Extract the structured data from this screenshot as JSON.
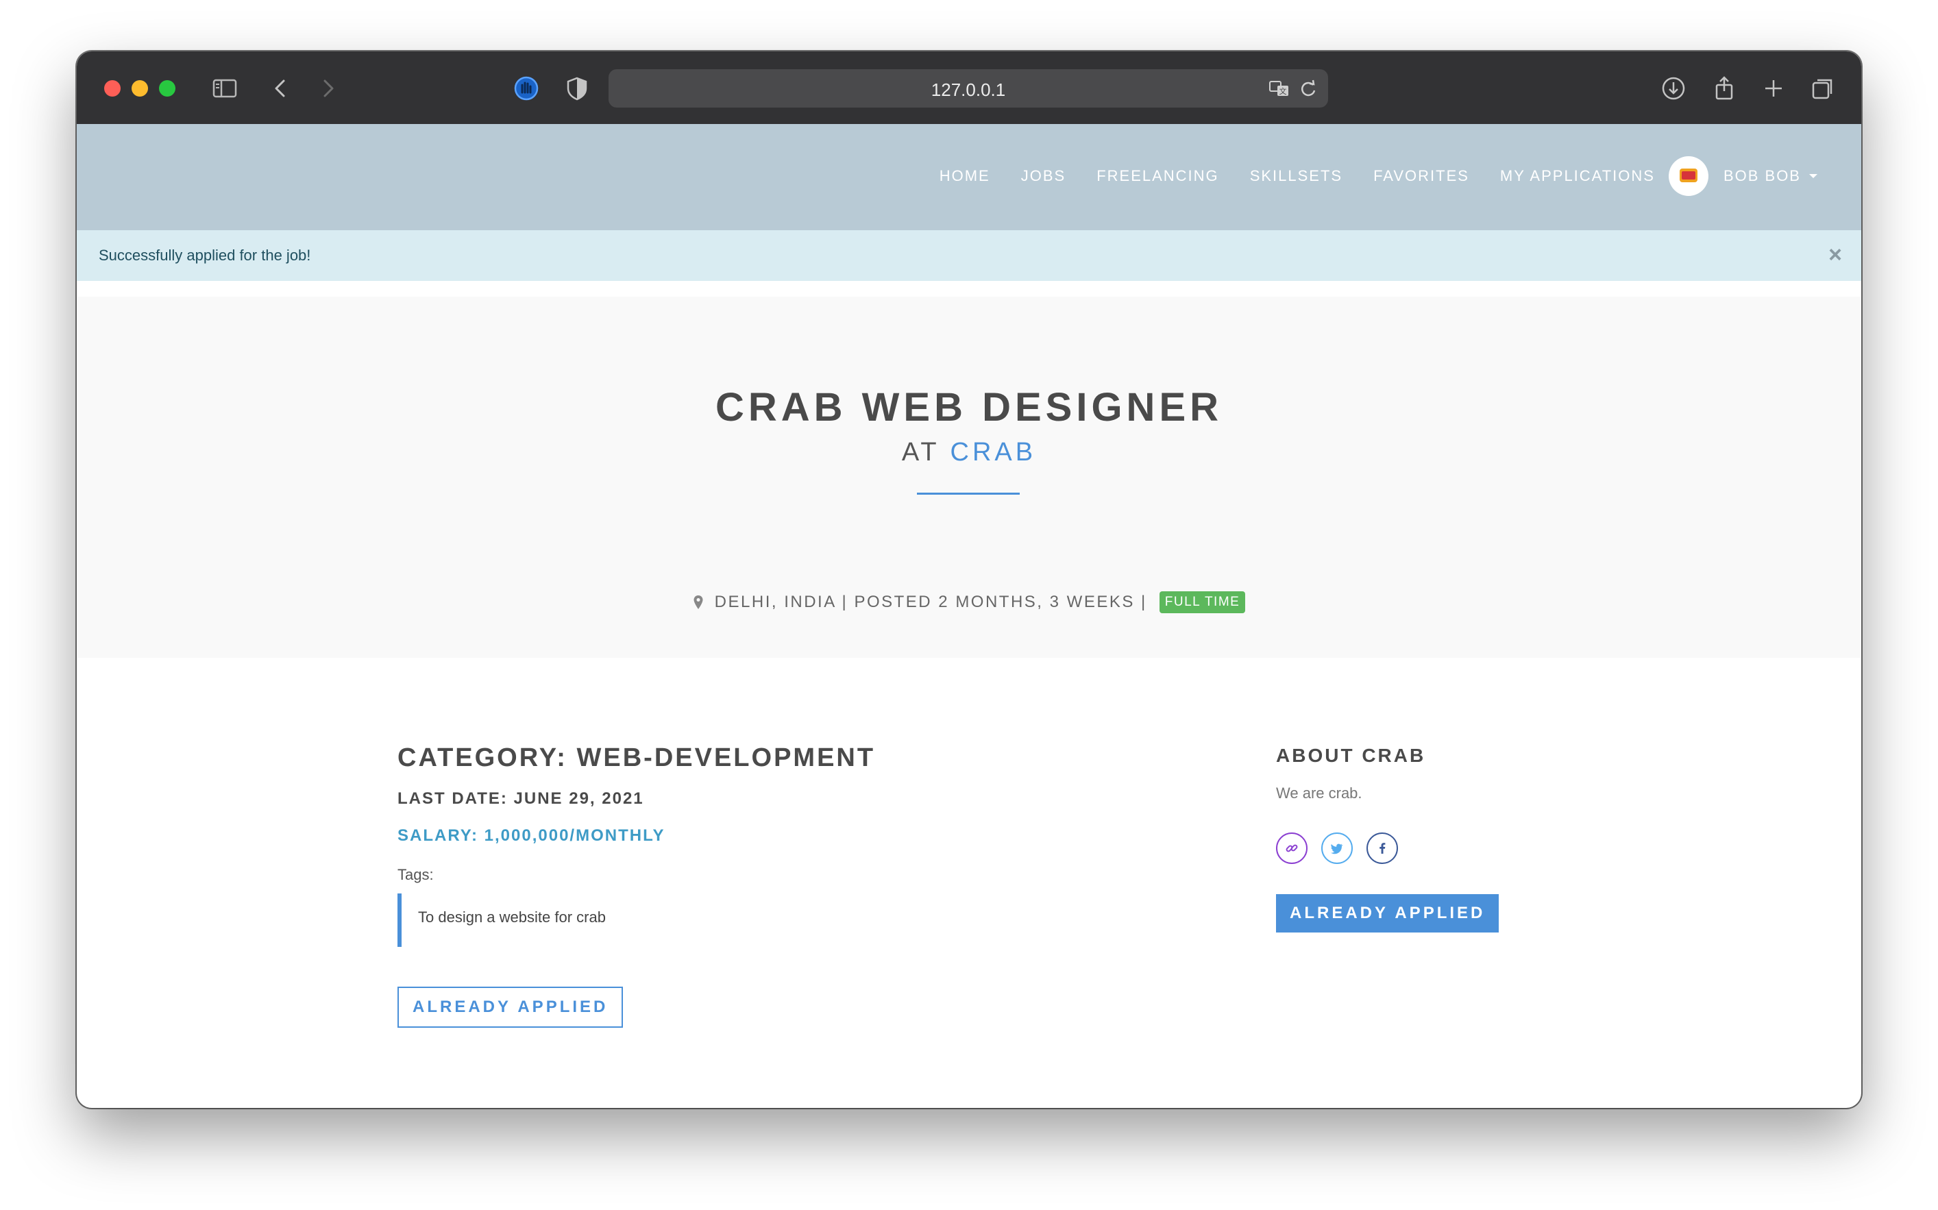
{
  "browser": {
    "url": "127.0.0.1"
  },
  "navbar": {
    "links": [
      "HOME",
      "JOBS",
      "FREELANCING",
      "SKILLSETS",
      "FAVORITES",
      "MY APPLICATIONS"
    ],
    "user_name": "BOB BOB"
  },
  "alert": {
    "message": "Successfully applied for the job!",
    "close": "×"
  },
  "job": {
    "title": "CRAB WEB DESIGNER",
    "at": "AT",
    "company": "CRAB",
    "meta": "DELHI, INDIA | POSTED 2 MONTHS, 3 WEEKS |",
    "badge": "FULL TIME",
    "category": "CATEGORY: WEB-DEVELOPMENT",
    "last_date": "LAST DATE: JUNE 29, 2021",
    "salary": "SALARY: 1,000,000/MONTHLY",
    "tags_label": "Tags:",
    "description": "To design a website for crab",
    "apply_button": "ALREADY APPLIED"
  },
  "about": {
    "title": "ABOUT CRAB",
    "text": "We are crab.",
    "apply_button": "ALREADY APPLIED"
  },
  "colors": {
    "accent": "#4a90d9",
    "navbar": "#b8cad5",
    "alert": "#d9ecf2",
    "badge": "#5cb85c",
    "link_icon": "#8b3fd1",
    "twitter_icon": "#55acee",
    "facebook_icon": "#3b5998"
  }
}
